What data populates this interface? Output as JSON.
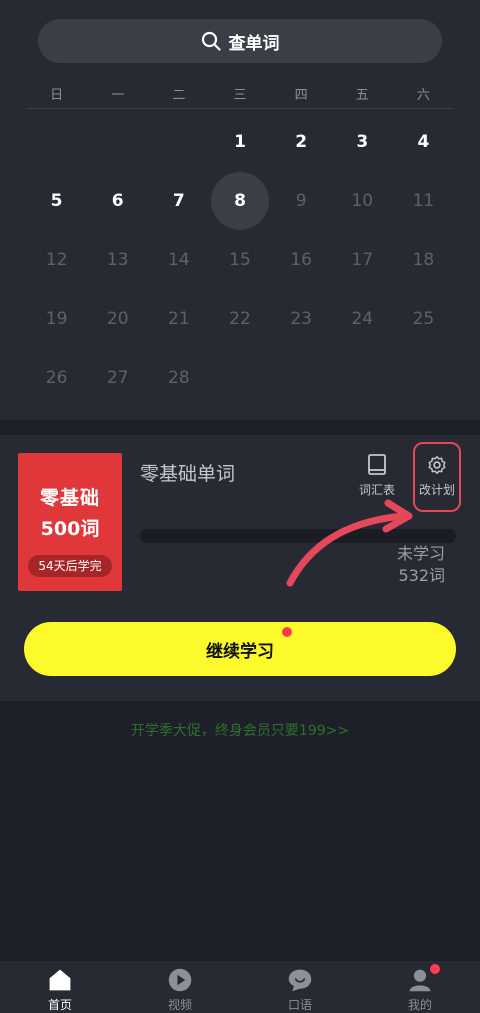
{
  "search": {
    "label": "查单词"
  },
  "calendar": {
    "weekdays": [
      "日",
      "一",
      "二",
      "三",
      "四",
      "五",
      "六"
    ],
    "rows": [
      [
        {
          "d": ""
        },
        {
          "d": ""
        },
        {
          "d": ""
        },
        {
          "d": "1",
          "s": "active"
        },
        {
          "d": "2",
          "s": "active"
        },
        {
          "d": "3",
          "s": "active"
        },
        {
          "d": "4",
          "s": "active"
        }
      ],
      [
        {
          "d": "5",
          "s": "active"
        },
        {
          "d": "6",
          "s": "active"
        },
        {
          "d": "7",
          "s": "active"
        },
        {
          "d": "8",
          "s": "today"
        },
        {
          "d": "9"
        },
        {
          "d": "10"
        },
        {
          "d": "11"
        }
      ],
      [
        {
          "d": "12"
        },
        {
          "d": "13"
        },
        {
          "d": "14"
        },
        {
          "d": "15"
        },
        {
          "d": "16"
        },
        {
          "d": "17"
        },
        {
          "d": "18"
        }
      ],
      [
        {
          "d": "19"
        },
        {
          "d": "20"
        },
        {
          "d": "21"
        },
        {
          "d": "22"
        },
        {
          "d": "23"
        },
        {
          "d": "24"
        },
        {
          "d": "25"
        }
      ],
      [
        {
          "d": "26"
        },
        {
          "d": "27"
        },
        {
          "d": "28"
        },
        {
          "d": ""
        },
        {
          "d": ""
        },
        {
          "d": ""
        },
        {
          "d": ""
        }
      ]
    ]
  },
  "book": {
    "cover_line1": "零基础",
    "cover_line2": "500词",
    "cover_badge": "54天后学完",
    "title": "零基础单词",
    "vocab_label": "词汇表",
    "plan_label": "改计划",
    "progress": 0,
    "status_line1": "未学习",
    "status_line2": "532词",
    "cta_label": "继续学习"
  },
  "promo": "开学季大促，终身会员只要199>>",
  "tabs": [
    {
      "label": "首页",
      "icon": "home-icon",
      "active": true
    },
    {
      "label": "视频",
      "icon": "play-icon"
    },
    {
      "label": "口语",
      "icon": "chat-icon"
    },
    {
      "label": "我的",
      "icon": "profile-icon"
    }
  ],
  "colors": {
    "accent": "#fdfa2b",
    "cover": "#e0373a",
    "notify": "#ff3b53",
    "annotation": "#e6475a"
  }
}
